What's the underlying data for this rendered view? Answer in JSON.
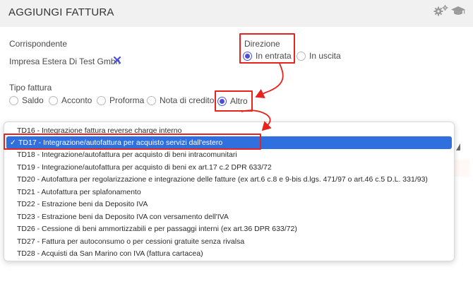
{
  "header": {
    "title": "AGGIUNGI FATTURA",
    "icons": [
      "gears-icon",
      "graduation-cap-icon"
    ]
  },
  "corrispondente": {
    "label": "Corrispondente",
    "value": "Impresa Estera Di Test Gmbh"
  },
  "direzione": {
    "label": "Direzione",
    "options": [
      {
        "label": "In entrata",
        "selected": true
      },
      {
        "label": "In uscita",
        "selected": false
      }
    ]
  },
  "tipo_fattura": {
    "label": "Tipo fattura",
    "options": [
      {
        "label": "Saldo",
        "selected": false
      },
      {
        "label": "Acconto",
        "selected": false
      },
      {
        "label": "Proforma",
        "selected": false
      },
      {
        "label": "Nota di credito",
        "selected": false
      },
      {
        "label": "Altro",
        "selected": true
      }
    ]
  },
  "dropdown": {
    "check_mark": "✓",
    "items": [
      "TD16 - Integrazione fattura reverse charge interno",
      "TD17 - Integrazione/autofattura per acquisto servizi dall'estero",
      "TD18 - Integrazione/autofattura per acquisto di beni intracomunitari",
      "TD19 - Integrazione/autofattura per acquisto di beni ex art.17 c.2 DPR 633/72",
      "TD20 - Autofattura per regolarizzazione e integrazione delle fatture (ex art.6 c.8 e 9-bis d.lgs. 471/97 o art.46 c.5 D.L. 331/93)",
      "TD21 - Autofattura per splafonamento",
      "TD22 - Estrazione beni da Deposito IVA",
      "TD23 - Estrazione beni da Deposito IVA con versamento dell'IVA",
      "TD26 - Cessione di beni ammortizzabili e per passaggi interni (ex art.36 DPR 633/72)",
      "TD27 - Fattura per autoconsumo o per cessioni gratuite senza rivalsa",
      "TD28 - Acquisti da San Marino con IVA (fattura cartacea)"
    ],
    "selected_index": 1
  },
  "colors": {
    "accent": "#4a4fe0",
    "highlight": "#e8231d",
    "selection": "#2f6fde"
  }
}
